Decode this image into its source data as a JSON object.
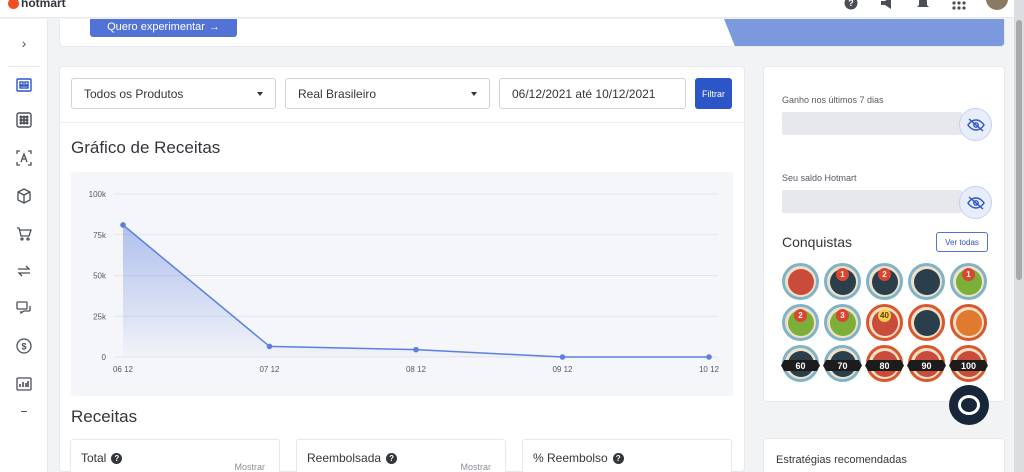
{
  "header": {
    "logo_text": "hotmart",
    "icons": [
      "help-icon",
      "megaphone-icon",
      "bell-icon",
      "apps-grid-icon"
    ]
  },
  "sidebar": {
    "items": [
      "dashboard-icon",
      "products-grid-icon",
      "affiliates-icon",
      "box-icon",
      "cart-icon",
      "refresh-icon",
      "chat-bubbles-icon",
      "dollar-icon",
      "report-chart-icon"
    ]
  },
  "promo": {
    "button_label": "Quero experimentar",
    "arrow": "→"
  },
  "filters": {
    "product": "Todos os Produtos",
    "currency": "Real Brasileiro",
    "date_range": "06/12/2021 até 10/12/2021",
    "filter_button": "Filtrar"
  },
  "chart_section": {
    "title": "Gráfico de Receitas"
  },
  "chart_data": {
    "type": "area",
    "x": [
      "06 12",
      "07 12",
      "08 12",
      "09 12",
      "10 12"
    ],
    "series": [
      {
        "values": [
          81000,
          6500,
          4500,
          0,
          0
        ]
      }
    ],
    "yticks": [
      "100k",
      "75k",
      "50k",
      "25k",
      "0"
    ],
    "ylim": [
      0,
      100000
    ],
    "grid": true,
    "color": "#5c7fe0"
  },
  "revenue": {
    "title": "Receitas",
    "cards": [
      {
        "label": "Total",
        "action": "Mostrar"
      },
      {
        "label": "Reembolsada",
        "action": "Mostrar"
      },
      {
        "label": "% Reembolso"
      }
    ]
  },
  "balance": {
    "earned_label": "Ganho nos últimos 7 dias",
    "saldo_label": "Seu saldo Hotmart",
    "achievements_title": "Conquistas",
    "see_all": "Ver todas",
    "badges": [
      {
        "name": "certificate-badge",
        "number": ""
      },
      {
        "name": "level-1-badge",
        "number": "1"
      },
      {
        "name": "level-2-badge",
        "number": "2"
      },
      {
        "name": "trophy-badge",
        "number": ""
      },
      {
        "name": "level-1-green-badge",
        "number": "1"
      },
      {
        "name": "level-2-green-badge",
        "number": "2"
      },
      {
        "name": "level-3-green-badge",
        "number": "3"
      },
      {
        "name": "award-40-badge",
        "number": "40"
      },
      {
        "name": "ninja-badge",
        "number": ""
      },
      {
        "name": "mountain-badge",
        "number": ""
      },
      {
        "name": "rank-60-badge",
        "number": "60"
      },
      {
        "name": "rank-70-badge",
        "number": "70"
      },
      {
        "name": "rank-80-badge",
        "number": "80"
      },
      {
        "name": "rank-90-badge",
        "number": "90"
      },
      {
        "name": "rank-100-badge",
        "number": "100"
      }
    ]
  },
  "strategies": {
    "title": "Estratégias recomendadas"
  }
}
